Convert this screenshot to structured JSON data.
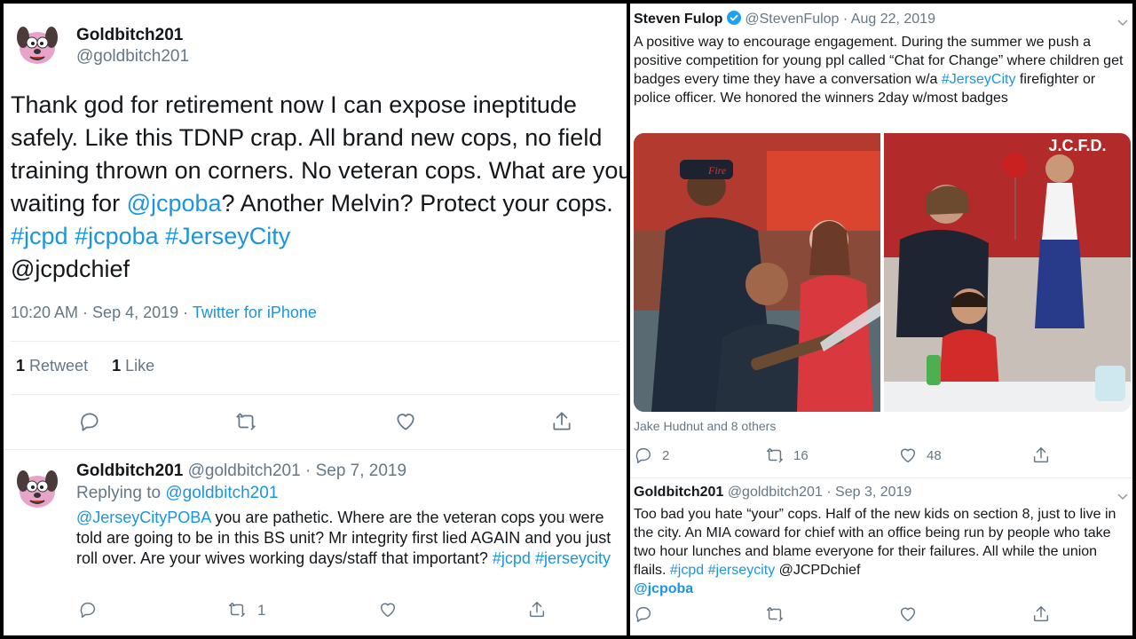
{
  "main_tweet": {
    "author_name": "Goldbitch201",
    "author_handle": "@goldbitch201",
    "text_parts": {
      "p1": "Thank god for retirement now I can expose ineptitude safely. Like this TDNP crap. All brand new cops, no field training thrown on corners. No veteran cops. What are you waiting for ",
      "m1": "@jcpoba",
      "p2": "? Another Melvin? Protect your cops. ",
      "h1": "#jcpd",
      "h2": "#jcpoba",
      "h3": "#JerseyCity",
      "p3": "@jcpdchief"
    },
    "time": "10:20 AM · Sep 4, 2019 · ",
    "source": "Twitter for iPhone",
    "retweets": "1",
    "retweets_label": "Retweet",
    "likes": "1",
    "likes_label": "Like",
    "icons": [
      "reply-icon",
      "retweet-icon",
      "like-icon",
      "share-icon"
    ]
  },
  "reply_tweet": {
    "author_name": "Goldbitch201",
    "author_handle": "@goldbitch201",
    "date": "· Sep 7, 2019",
    "replying_to_label": "Replying to ",
    "replying_to_handle": "@goldbitch201",
    "text_parts": {
      "m1": "@JerseyCityPOBA",
      "p1": " you are pathetic. Where are the veteran cops you were told are going to be in this BS unit? Mr integrity first lied AGAIN and you just roll over. Are your wives working days/staff that important? ",
      "h1": "#jcpd",
      "h2": "#jerseycity"
    },
    "retweets": "1"
  },
  "fulop_tweet": {
    "author_name": "Steven Fulop",
    "author_handle": "@StevenFulop",
    "date": "· Aug 22, 2019",
    "verified": true,
    "text_parts": {
      "p1": "A positive way to encourage engagement. During the summer we push a positive competition for young ppl called “Chat for Change” where children get badges every time they have a conversation w/a ",
      "h1": "#JerseyCity",
      "p2": " firefighter or police officer. We honored the winners 2day w/most badges"
    },
    "photo_sign_text": "J.C.F.D.",
    "photo_helmet_text": "Fire",
    "liked_by": "Jake Hudnut and 8 others",
    "replies": "2",
    "retweets": "16",
    "likes": "48"
  },
  "gold_reply_2": {
    "author_name": "Goldbitch201",
    "author_handle": "@goldbitch201",
    "date": "· Sep 3, 2019",
    "text_parts": {
      "p1": "Too bad you hate “your” cops. Half of the new kids on section 8, just to live in the city. An MIA coward for chief with an office being run by people who take two hour lunches and blame everyone for their failures. All while the union flails. ",
      "h1": "#jcpd",
      "h2": "#jerseycity",
      "p2": " @JCPDchief",
      "m1": "@jcpoba"
    }
  },
  "colors": {
    "link": "#1b95e0",
    "secondary": "#657786",
    "text": "#14171a",
    "verified": "#1da1f2"
  }
}
